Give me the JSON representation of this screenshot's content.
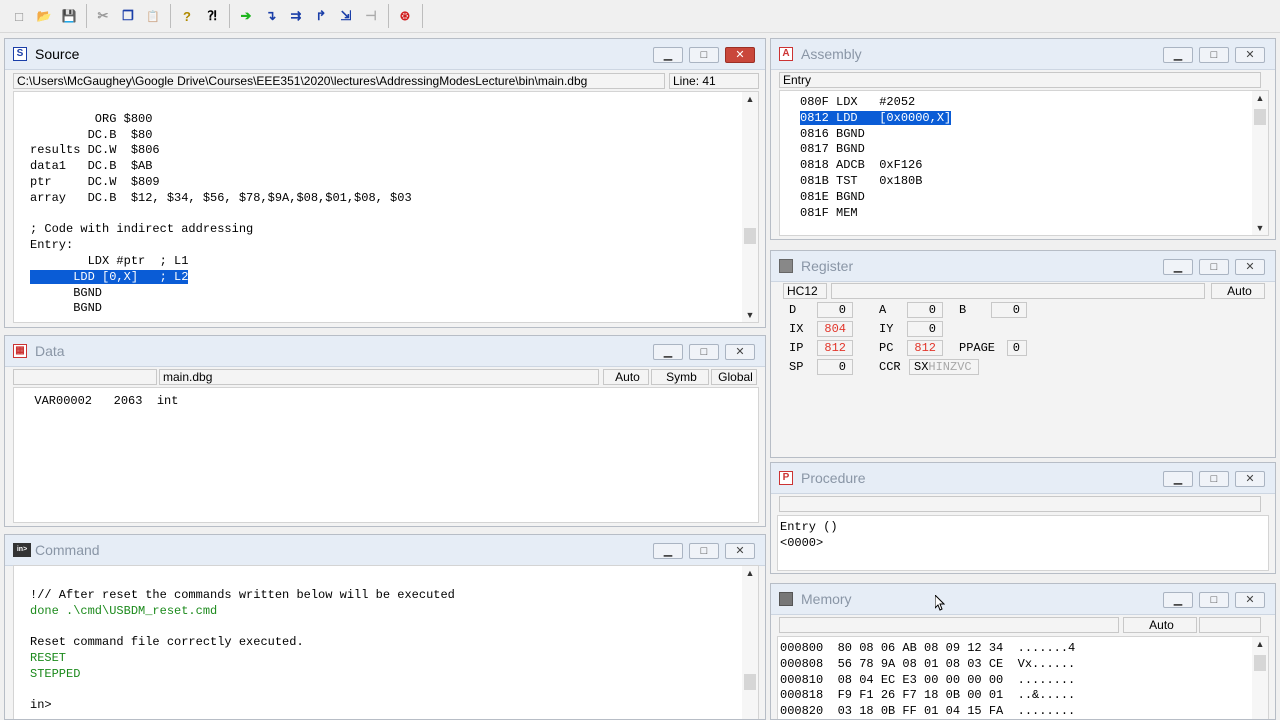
{
  "toolbar": {
    "buttons": [
      {
        "name": "new-icon",
        "glyph": "□"
      },
      {
        "name": "open-icon",
        "glyph": "📂"
      },
      {
        "name": "save-icon",
        "glyph": "💾"
      },
      {
        "name": "cut-icon",
        "glyph": "✂"
      },
      {
        "name": "copy-icon",
        "glyph": "❐"
      },
      {
        "name": "paste-icon",
        "glyph": "📋"
      },
      {
        "name": "help-icon",
        "glyph": "?"
      },
      {
        "name": "context-help-icon",
        "glyph": "⁈"
      },
      {
        "name": "start-icon",
        "glyph": "➔"
      },
      {
        "name": "single-step-icon",
        "glyph": "↴"
      },
      {
        "name": "step-over-icon",
        "glyph": "⇉"
      },
      {
        "name": "step-out-icon",
        "glyph": "↱"
      },
      {
        "name": "assembly-step-icon",
        "glyph": "⇲"
      },
      {
        "name": "halt-icon",
        "glyph": "⊣"
      },
      {
        "name": "reset-icon",
        "glyph": "⊛"
      }
    ]
  },
  "source": {
    "title": "Source",
    "path": "C:\\Users\\McGaughey\\Google Drive\\Courses\\EEE351\\2020\\lectures\\AddressingModesLecture\\bin\\main.dbg",
    "line": "Line: 41",
    "lines": [
      "",
      "         ORG $800",
      "        DC.B  $80",
      "results DC.W  $806",
      "data1   DC.B  $AB",
      "ptr     DC.W  $809",
      "array   DC.B  $12, $34, $56, $78,$9A,$08,$01,$08, $03",
      "",
      "; Code with indirect addressing",
      "Entry:",
      "        LDX #ptr  ; L1",
      "      LDD [0,X]   ; L2",
      "      BGND",
      "      BGND"
    ],
    "selected_line": 11
  },
  "data_win": {
    "title": "Data",
    "file": "main.dbg",
    "auto": "Auto",
    "symb": "Symb",
    "global": "Global",
    "row": "  VAR00002   2063  int"
  },
  "command": {
    "title": "Command",
    "lines": [
      {
        "text": "",
        "green": false
      },
      {
        "text": "!// After reset the commands written below will be executed",
        "green": false
      },
      {
        "text": "done .\\cmd\\USBDM_reset.cmd",
        "green": true
      },
      {
        "text": "",
        "green": false
      },
      {
        "text": "Reset command file correctly executed.",
        "green": false
      },
      {
        "text": "RESET",
        "green": true
      },
      {
        "text": "STEPPED",
        "green": true
      },
      {
        "text": "",
        "green": false
      },
      {
        "text": "in>",
        "green": false
      }
    ]
  },
  "assembly": {
    "title": "Assembly",
    "header": "Entry",
    "lines": [
      "080F LDX   #2052",
      "0812 LDD   [0x0000,X]",
      "0816 BGND",
      "0817 BGND",
      "0818 ADCB  0xF126",
      "081B TST   0x180B",
      "081E BGND",
      "081F MEM"
    ],
    "selected_line": 1
  },
  "register": {
    "title": "Register",
    "cpu": "HC12",
    "auto": "Auto",
    "rows": [
      [
        {
          "label": "D",
          "value": "0",
          "red": false
        },
        {
          "label": "A",
          "value": "0",
          "red": false
        },
        {
          "label": "B",
          "value": "0",
          "red": false
        }
      ],
      [
        {
          "label": "IX",
          "value": "804",
          "red": true
        },
        {
          "label": "IY",
          "value": "0",
          "red": false
        }
      ],
      [
        {
          "label": "IP",
          "value": "812",
          "red": true
        },
        {
          "label": "PC",
          "value": "812",
          "red": true
        },
        {
          "label": "PPAGE",
          "value": "0",
          "red": false
        }
      ],
      [
        {
          "label": "SP",
          "value": "0",
          "red": false
        },
        {
          "label": "CCR",
          "value": "",
          "red": false
        }
      ]
    ],
    "ccr_prefix": "SX",
    "ccr_rest": "HINZVC"
  },
  "procedure": {
    "title": "Procedure",
    "lines": [
      "Entry ()",
      "<0000>"
    ]
  },
  "memory": {
    "title": "Memory",
    "auto": "Auto",
    "lines": [
      "000800  80 08 06 AB 08 09 12 34  .......4",
      "000808  56 78 9A 08 01 08 03 CE  Vx......",
      "000810  08 04 EC E3 00 00 00 00  ........",
      "000818  F9 F1 26 F7 18 0B 00 01  ..&.....",
      "000820  03 18 0B FF 01 04 15 FA  ........"
    ]
  }
}
